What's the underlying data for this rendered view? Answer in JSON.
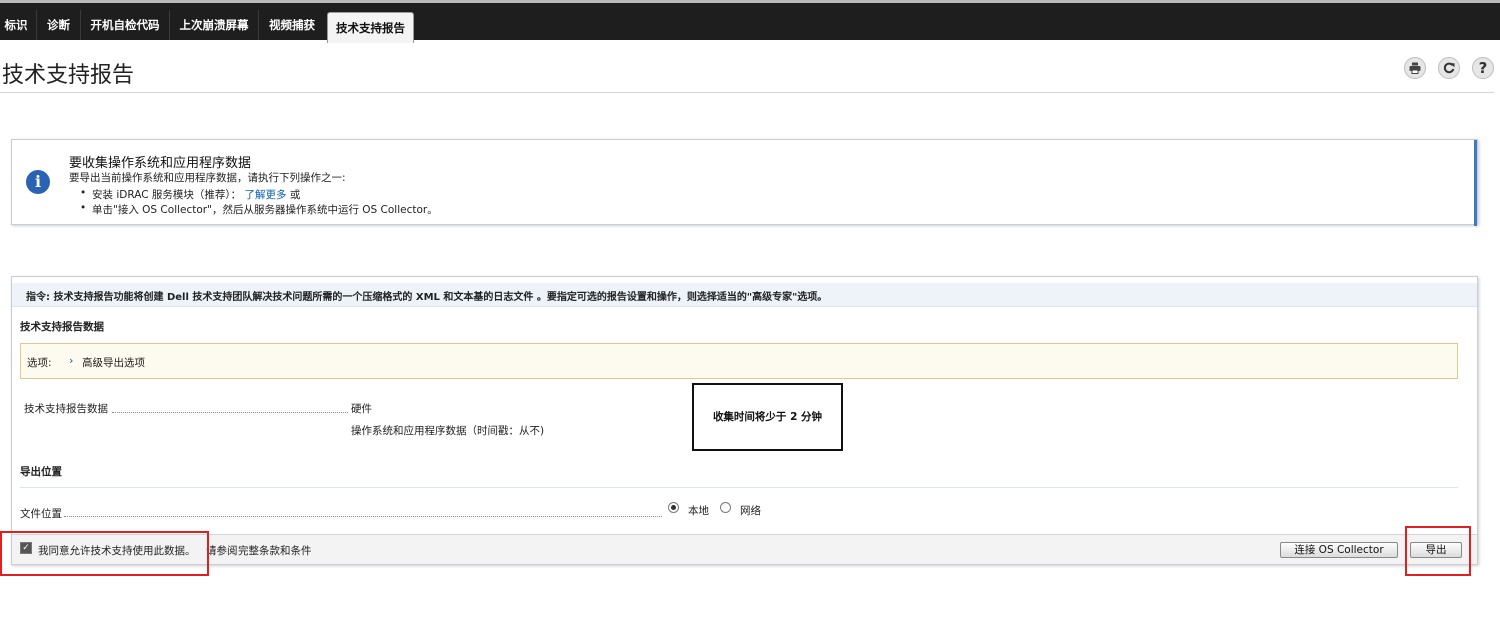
{
  "tabs": [
    {
      "label": "标识"
    },
    {
      "label": "诊断"
    },
    {
      "label": "开机自检代码"
    },
    {
      "label": "上次崩溃屏幕"
    },
    {
      "label": "视频捕获"
    },
    {
      "label": "技术支持报告"
    }
  ],
  "page": {
    "title": "技术支持报告"
  },
  "toolbar": {
    "print_icon": "printer-icon",
    "refresh_icon": "refresh-icon",
    "help_icon": "help-icon",
    "help_glyph": "?"
  },
  "info": {
    "icon_glyph": "i",
    "title": "要收集操作系统和应用程序数据",
    "subtitle": "要导出当前操作系统和应用程序数据，请执行下列操作之一:",
    "item1_prefix": "安装 iDRAC 服务模块（推荐）：",
    "item1_link": "了解更多",
    "item1_suffix": "或",
    "item2": "单击\"接入 OS Collector\"，然后从服务器操作系统中运行 OS Collector。"
  },
  "main": {
    "instruction": "指令: 技术支持报告功能将创建 Dell 技术支持团队解决技术问题所需的一个压缩格式的 XML 和文本基的日志文件 。要指定可选的报告设置和操作，则选择适当的\"高级专家\"选项。",
    "data_section_title": "技术支持报告数据",
    "options_label": "选项:",
    "advanced_link": "高级导出选项",
    "report_data_label": "技术支持报告数据",
    "hardware": "硬件",
    "os_app_data": "操作系统和应用程序数据（时间戳：从不)",
    "collect_time": "收集时间将少于 2 分钟",
    "export_location_title": "导出位置",
    "file_location_label": "文件位置",
    "radio_local": "本地",
    "radio_network": "网络",
    "selected_location": "本地"
  },
  "footer": {
    "agree_text": "我同意允许技术支持使用此数据。",
    "see_text": "请参阅",
    "terms_link": "完整条款和条件",
    "checked": true,
    "connect_button": "连接 OS Collector",
    "export_button": "导出"
  },
  "colors": {
    "accent": "#2a63b3",
    "highlight_border": "#e02020",
    "tab_bar": "#1e1e1e"
  }
}
